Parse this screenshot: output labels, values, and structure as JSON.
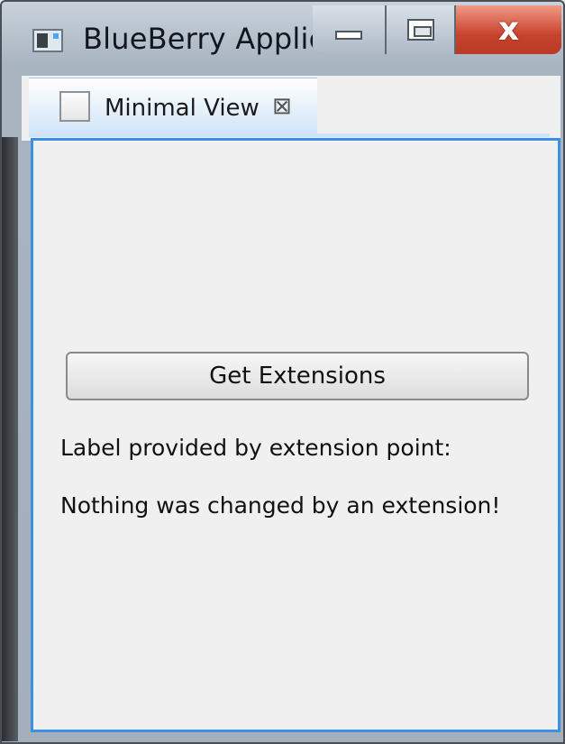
{
  "window": {
    "title": "BlueBerry Applic...",
    "app_icon": "application-icon",
    "buttons": {
      "minimize_icon": "minimize-icon",
      "maximize_icon": "maximize-icon",
      "close_label": "x"
    }
  },
  "tab": {
    "label": "Minimal View",
    "icon": "view-icon",
    "close_glyph": "⊠"
  },
  "main": {
    "button_label": "Get Extensions",
    "label_caption": "Label provided by extension point:",
    "label_value": "Nothing was changed by an extension!"
  },
  "colors": {
    "focus_border": "#3b8fe8",
    "close_button": "#c8432d",
    "tab_active": "#cfe3f7"
  }
}
